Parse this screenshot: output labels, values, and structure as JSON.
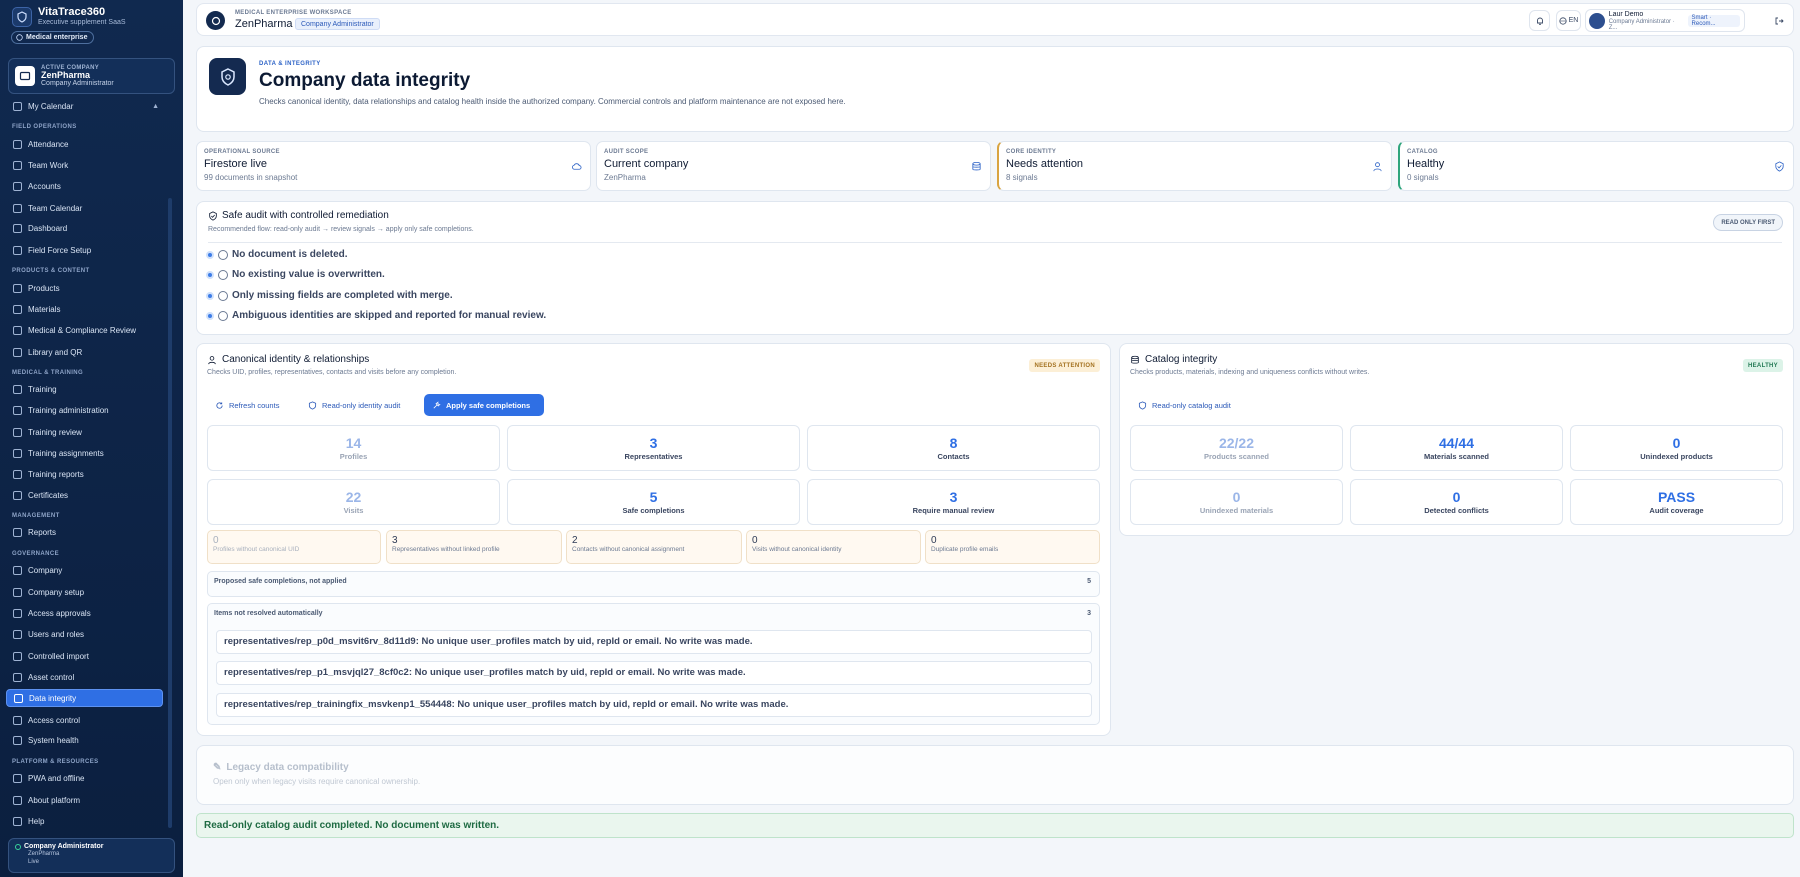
{
  "sidebar": {
    "brand_name": "VitaTrace360",
    "brand_tagline": "Executive supplement SaaS",
    "pill": "Medical enterprise",
    "active_company": {
      "kicker": "ACTIVE COMPANY",
      "name": "ZenPharma",
      "role": "Company Administrator"
    },
    "calendar": "My Calendar",
    "sections": {
      "field": "FIELD OPERATIONS",
      "products": "PRODUCTS & CONTENT",
      "training": "MEDICAL & TRAINING",
      "management": "MANAGEMENT",
      "governance": "GOVERNANCE",
      "platform": "PLATFORM & RESOURCES"
    },
    "items": {
      "attendance": "Attendance",
      "team_work": "Team Work",
      "accounts": "Accounts",
      "team_calendar": "Team Calendar",
      "dashboard": "Dashboard",
      "field_force": "Field Force Setup",
      "products": "Products",
      "materials": "Materials",
      "med_review": "Medical & Compliance Review",
      "library": "Library and QR",
      "training": "Training",
      "training_admin": "Training administration",
      "training_review": "Training review",
      "training_assign": "Training assignments",
      "training_reports": "Training reports",
      "certificates": "Certificates",
      "reports": "Reports",
      "company": "Company",
      "company_setup": "Company setup",
      "access_approvals": "Access approvals",
      "users_roles": "Users and roles",
      "controlled_import": "Controlled import",
      "asset_control": "Asset control",
      "data_integrity": "Data integrity",
      "access_control": "Access control",
      "system_health": "System health",
      "pwa": "PWA and offline",
      "about": "About platform",
      "help": "Help"
    },
    "footer": {
      "role": "Company Administrator",
      "company": "ZenPharma",
      "status": "Live"
    }
  },
  "header": {
    "workspace": "MEDICAL ENTERPRISE WORKSPACE",
    "company": "ZenPharma",
    "role_badge": "Company Administrator",
    "lang": "EN",
    "user_name": "Laur Demo",
    "user_role": "Company Administrator · Z...",
    "mode": "Smart · Recom..."
  },
  "page": {
    "kicker": "DATA & INTEGRITY",
    "title": "Company data integrity",
    "description": "Checks canonical identity, data relationships and catalog health inside the authorized company. Commercial controls and platform maintenance are not exposed here."
  },
  "stats": [
    {
      "kicker": "OPERATIONAL SOURCE",
      "value": "Firestore live",
      "sub": "99 documents in snapshot",
      "icon": "cloud-icon"
    },
    {
      "kicker": "AUDIT SCOPE",
      "value": "Current company",
      "sub": "ZenPharma",
      "icon": "database-icon"
    },
    {
      "kicker": "CORE IDENTITY",
      "value": "Needs attention",
      "sub": "8 signals",
      "icon": "user-icon"
    },
    {
      "kicker": "CATALOG",
      "value": "Healthy",
      "sub": "0 signals",
      "icon": "shield-check-icon"
    }
  ],
  "safe_audit": {
    "title": "Safe audit with controlled remediation",
    "subtitle": "Recommended flow: read-only audit → review signals → apply only safe completions.",
    "badge": "READ ONLY FIRST",
    "rules": [
      "No document is deleted.",
      "No existing value is overwritten.",
      "Only missing fields are completed with merge.",
      "Ambiguous identities are skipped and reported for manual review."
    ]
  },
  "identity": {
    "title": "Canonical identity & relationships",
    "subtitle": "Checks UID, profiles, representatives, contacts and visits before any completion.",
    "tag": "NEEDS ATTENTION",
    "buttons": {
      "refresh": "Refresh counts",
      "audit": "Read-only identity audit",
      "apply": "Apply safe completions"
    },
    "metrics": [
      {
        "value": "14",
        "label": "Profiles"
      },
      {
        "value": "3",
        "label": "Representatives"
      },
      {
        "value": "8",
        "label": "Contacts"
      },
      {
        "value": "22",
        "label": "Visits"
      },
      {
        "value": "5",
        "label": "Safe completions"
      },
      {
        "value": "3",
        "label": "Require manual review"
      }
    ],
    "signals": [
      {
        "value": "0",
        "label": "Profiles without canonical UID"
      },
      {
        "value": "3",
        "label": "Representatives without linked profile"
      },
      {
        "value": "2",
        "label": "Contacts without canonical assignment"
      },
      {
        "value": "0",
        "label": "Visits without canonical identity"
      },
      {
        "value": "0",
        "label": "Duplicate profile emails"
      }
    ],
    "proposed": {
      "label": "Proposed safe completions, not applied",
      "count": "5"
    },
    "unresolved": {
      "label": "Items not resolved automatically",
      "count": "3",
      "items": [
        "representatives/rep_p0d_msvit6rv_8d11d9: No unique user_profiles match by uid, repId or email. No write was made.",
        "representatives/rep_p1_msvjql27_8cf0c2: No unique user_profiles match by uid, repId or email. No write was made.",
        "representatives/rep_trainingfix_msvkenp1_554448: No unique user_profiles match by uid, repId or email. No write was made."
      ]
    }
  },
  "catalog": {
    "title": "Catalog integrity",
    "subtitle": "Checks products, materials, indexing and uniqueness conflicts without writes.",
    "tag": "HEALTHY",
    "button": "Read-only catalog audit",
    "metrics": [
      {
        "value": "22/22",
        "label": "Products scanned"
      },
      {
        "value": "44/44",
        "label": "Materials scanned"
      },
      {
        "value": "0",
        "label": "Unindexed products"
      },
      {
        "value": "0",
        "label": "Unindexed materials"
      },
      {
        "value": "0",
        "label": "Detected conflicts"
      },
      {
        "value": "PASS",
        "label": "Audit coverage"
      }
    ]
  },
  "legacy": {
    "title": "Legacy data compatibility",
    "subtitle": "Open only when legacy visits require canonical ownership."
  },
  "toast": "Read-only catalog audit completed. No document was written."
}
